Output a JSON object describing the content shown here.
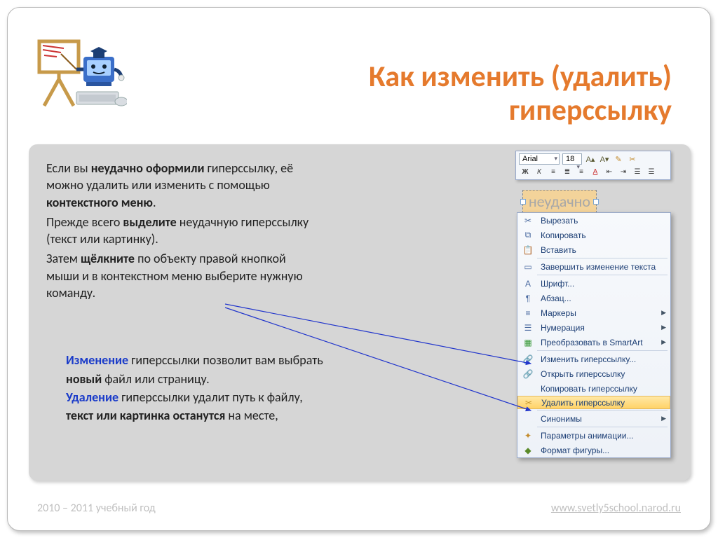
{
  "title_line1": "Как изменить (удалить)",
  "title_line2": "гиперссылку",
  "para1_a": "Если вы ",
  "para1_b": "неудачно оформили",
  "para1_c": " гиперссылку, её",
  "para1_d": "можно удалить или изменить с помощью",
  "para1_e": "контекстного меню",
  "para1_f": ".",
  "para2_a": "Прежде всего ",
  "para2_b": "выделите",
  "para2_c": " неудачную гиперссылку",
  "para2_d": "(текст или картинку).",
  "para3_a": "Затем ",
  "para3_b": "щёлкните",
  "para3_c": " по объекту правой кнопкой",
  "para3_d": "мыши и в контекстном меню выберите нужную",
  "para3_e": "команду.",
  "blue1_a": "Изменение",
  "blue1_b": " гиперссылки позволит вам выбрать",
  "blue2_a": "новый",
  "blue2_b": " файл или страницу.",
  "blue3_a": "Удаление",
  "blue3_b": " гиперссылки удалит путь к файлу,",
  "blue4_a": "текст или картинка останутся",
  "blue4_b": " на месте,",
  "footer_left": "2010 – 2011 учебный год",
  "footer_right": "www.svetly5school.narod.ru",
  "selected_label": "неудачно",
  "toolbar": {
    "font": "Arial",
    "size": "18"
  },
  "ctx": {
    "cut": "Вырезать",
    "copy": "Копировать",
    "paste": "Вставить",
    "endedit": "Завершить изменение текста",
    "font": "Шрифт...",
    "paragraph": "Абзац...",
    "bullets": "Маркеры",
    "numbering": "Нумерация",
    "smartart": "Преобразовать в SmartArt",
    "edithl": "Изменить гиперссылку...",
    "openhl": "Открыть гиперссылку",
    "copyhl": "Копировать гиперссылку",
    "removehl": "Удалить гиперссылку",
    "synonyms": "Синонимы",
    "anim": "Параметры анимации...",
    "format": "Формат фигуры..."
  }
}
